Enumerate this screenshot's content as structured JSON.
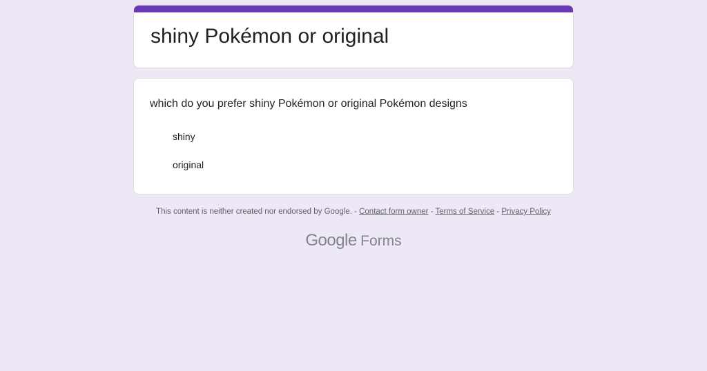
{
  "form": {
    "title": "shiny Pokémon or original",
    "accent_color": "#673ab7",
    "background_color": "#ede7f6"
  },
  "question": {
    "text": "which do you prefer shiny Pokémon or original Pokémon designs",
    "options": [
      "shiny",
      "original"
    ]
  },
  "footer": {
    "disclaimer": "This content is neither created nor endorsed by Google. - ",
    "contact_link": "Contact form owner",
    "sep1": " - ",
    "terms_link": "Terms of Service",
    "sep2": " - ",
    "privacy_link": "Privacy Policy"
  },
  "brand": {
    "google": "Google",
    "product": "Forms"
  }
}
